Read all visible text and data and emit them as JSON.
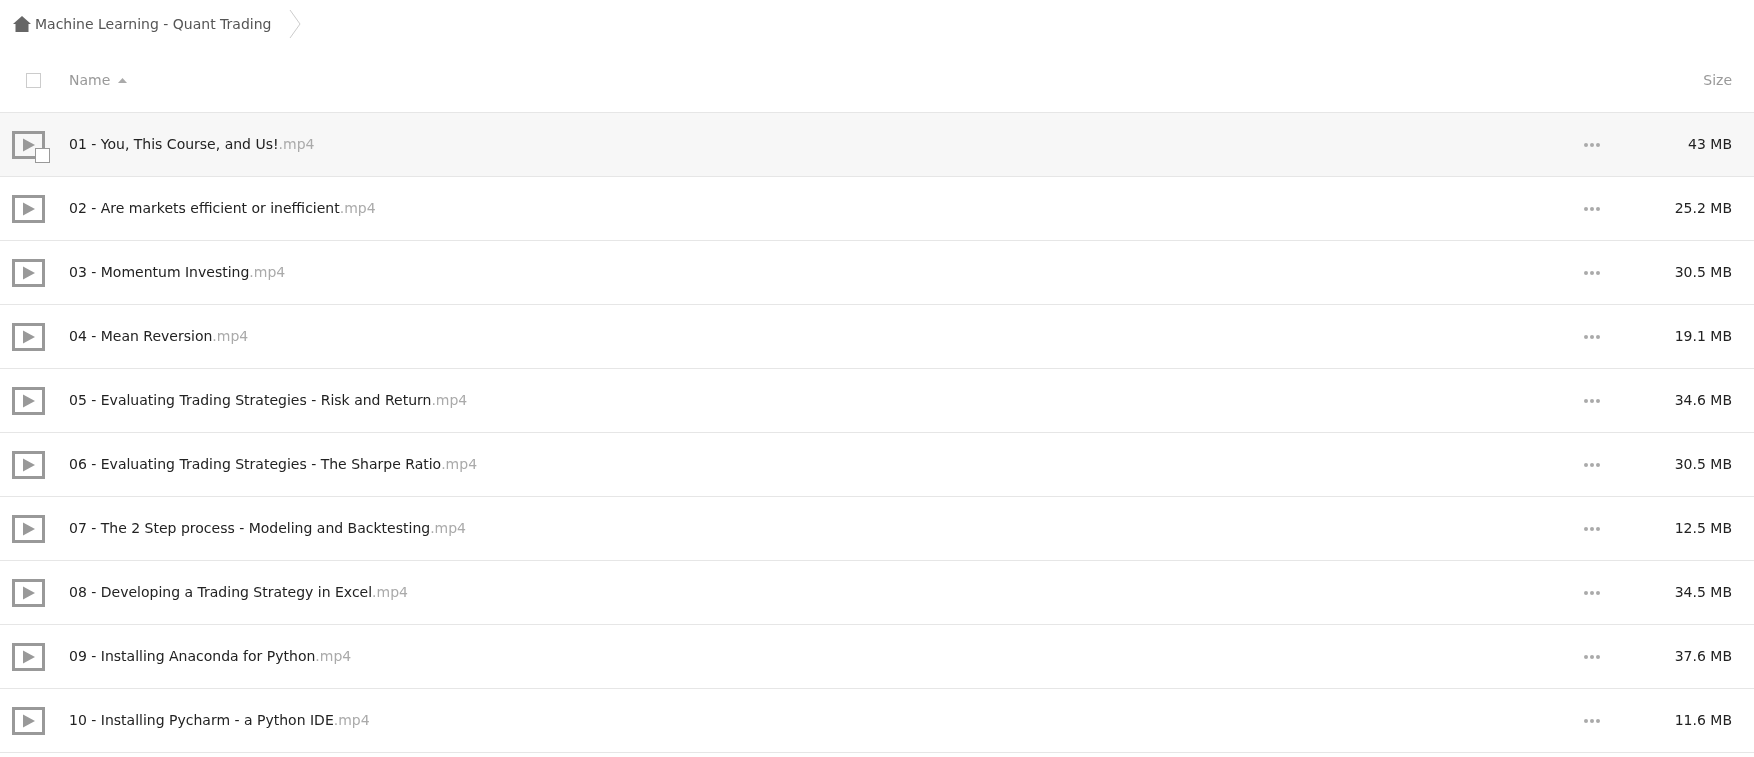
{
  "breadcrumb": {
    "title": "Machine Learning - Quant Trading"
  },
  "columns": {
    "select_all_checked": false,
    "name": "Name",
    "sorted_ascending": true,
    "size": "Size"
  },
  "rows": [
    {
      "name": "01 - You, This Course, and Us!",
      "ext": ".mp4",
      "size": "43 MB",
      "hovered": true
    },
    {
      "name": "02 - Are markets efficient or inefficient",
      "ext": ".mp4",
      "size": "25.2 MB",
      "hovered": false
    },
    {
      "name": "03 - Momentum Investing",
      "ext": ".mp4",
      "size": "30.5 MB",
      "hovered": false
    },
    {
      "name": "04 - Mean Reversion",
      "ext": ".mp4",
      "size": "19.1 MB",
      "hovered": false
    },
    {
      "name": "05 - Evaluating Trading Strategies - Risk and Return",
      "ext": ".mp4",
      "size": "34.6 MB",
      "hovered": false
    },
    {
      "name": "06 - Evaluating Trading Strategies - The Sharpe Ratio",
      "ext": ".mp4",
      "size": "30.5 MB",
      "hovered": false
    },
    {
      "name": "07 - The 2 Step process - Modeling and Backtesting",
      "ext": ".mp4",
      "size": "12.5 MB",
      "hovered": false
    },
    {
      "name": "08 - Developing a Trading Strategy in Excel",
      "ext": ".mp4",
      "size": "34.5 MB",
      "hovered": false
    },
    {
      "name": "09 - Installing Anaconda for Python",
      "ext": ".mp4",
      "size": "37.6 MB",
      "hovered": false
    },
    {
      "name": "10 - Installing Pycharm - a Python IDE",
      "ext": ".mp4",
      "size": "11.6 MB",
      "hovered": false
    }
  ]
}
